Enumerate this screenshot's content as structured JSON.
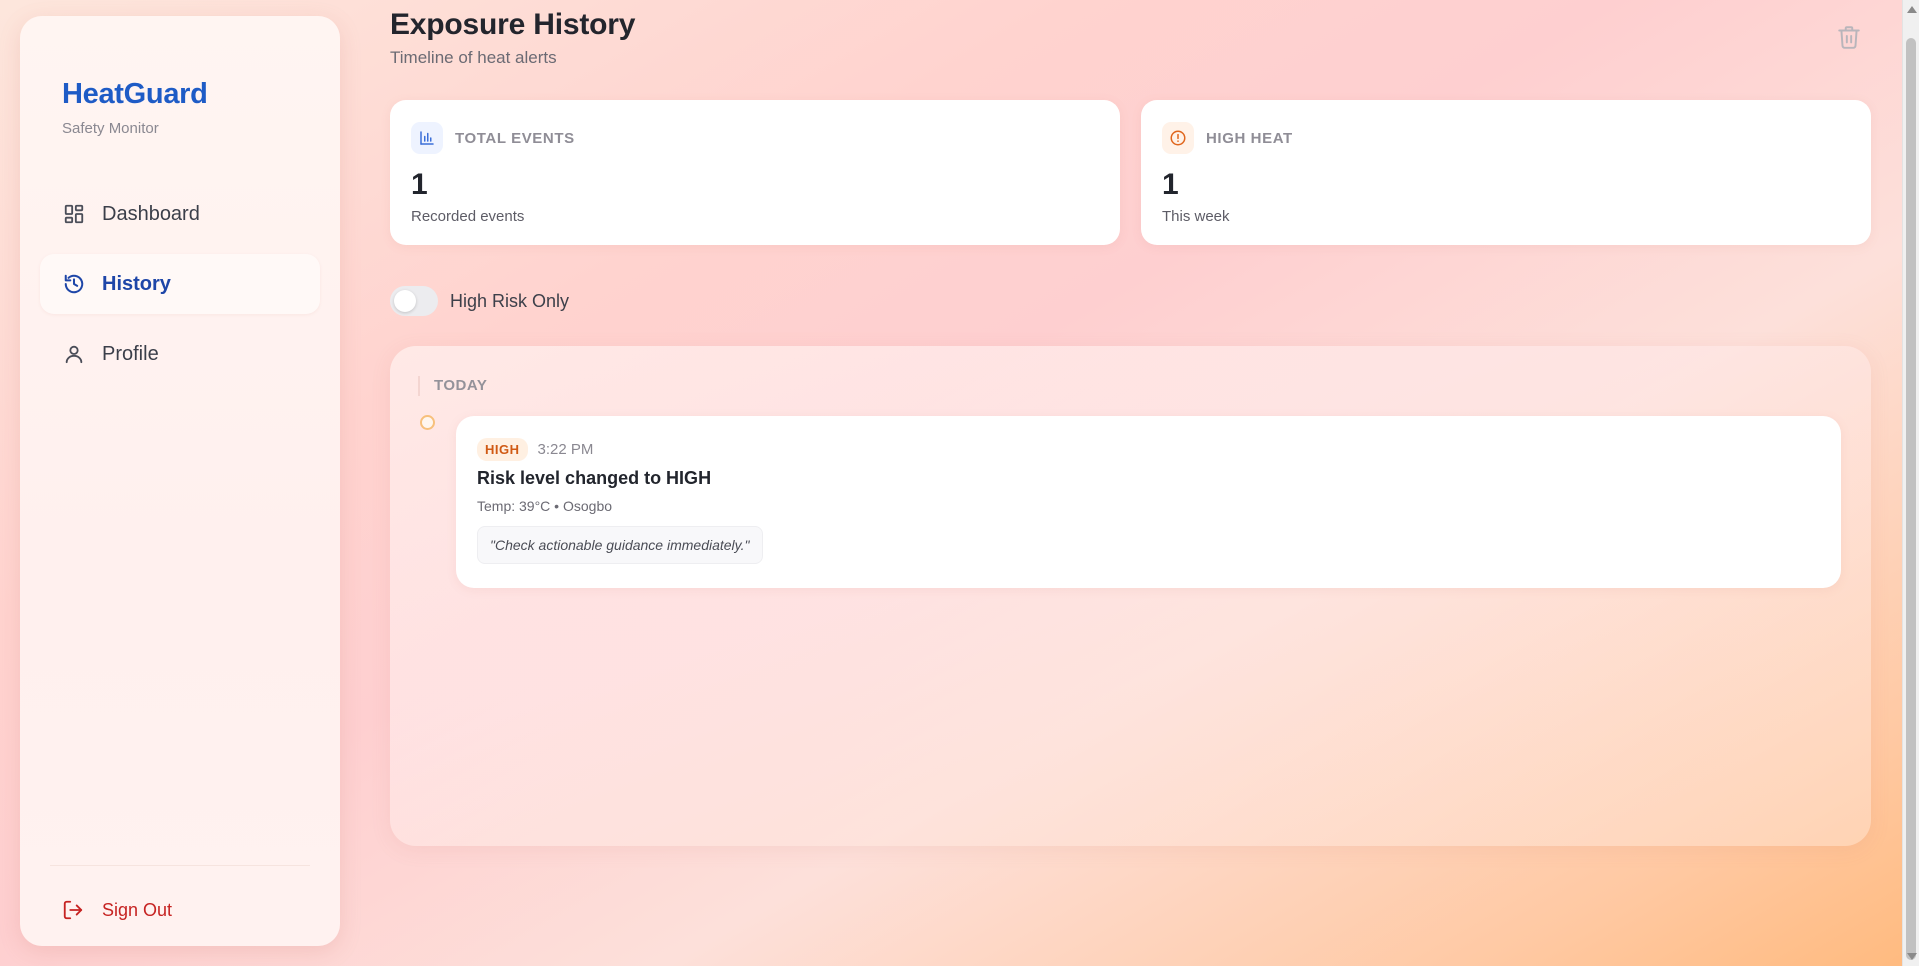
{
  "brand": {
    "name": "HeatGuard",
    "subtitle": "Safety Monitor"
  },
  "nav": {
    "items": [
      {
        "label": "Dashboard",
        "icon": "dashboard-icon",
        "active": false
      },
      {
        "label": "History",
        "icon": "history-icon",
        "active": true
      },
      {
        "label": "Profile",
        "icon": "profile-icon",
        "active": false
      }
    ],
    "signout_label": "Sign Out"
  },
  "header": {
    "title": "Exposure History",
    "subtitle": "Timeline of heat alerts"
  },
  "stats": {
    "total": {
      "label": "TOTAL EVENTS",
      "value": "1",
      "caption": "Recorded events",
      "icon": "bar-chart-icon"
    },
    "high": {
      "label": "HIGH HEAT",
      "value": "1",
      "caption": "This week",
      "icon": "alert-circle-icon"
    }
  },
  "filter": {
    "label": "High Risk Only",
    "enabled": false
  },
  "timeline": {
    "group_label": "TODAY",
    "events": [
      {
        "badge": "HIGH",
        "time": "3:22 PM",
        "title": "Risk level changed to HIGH",
        "details": "Temp: 39°C • Osogbo",
        "quote": "\"Check actionable guidance immediately.\""
      }
    ]
  },
  "colors": {
    "brand": "#1e5bc6",
    "active_nav": "#1e46a8",
    "signout": "#c62322",
    "badge_text": "#d05a14",
    "badge_bg": "#fff0e2"
  }
}
